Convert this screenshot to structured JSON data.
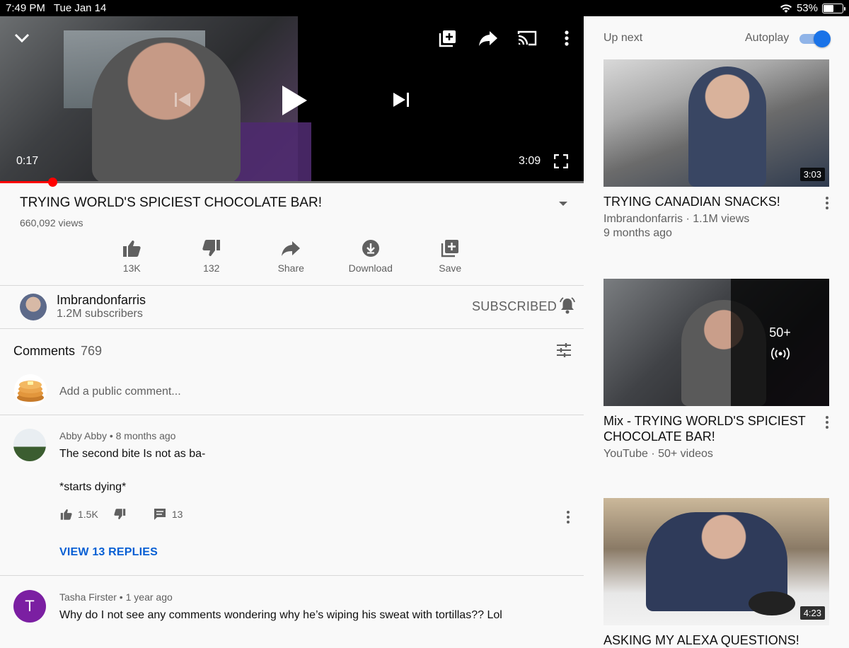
{
  "status": {
    "time": "7:49 PM",
    "date": "Tue Jan 14",
    "battery": "53%",
    "battery_level": 0.53
  },
  "player": {
    "current_time": "0:17",
    "duration": "3:09",
    "progress": 0.09
  },
  "video": {
    "title": "TRYING WORLD'S SPICIEST CHOCOLATE BAR!",
    "views": "660,092 views",
    "actions": [
      {
        "label": "13K",
        "icon": "thumbs-up-icon"
      },
      {
        "label": "132",
        "icon": "thumbs-down-icon"
      },
      {
        "label": "Share",
        "icon": "share-icon"
      },
      {
        "label": "Download",
        "icon": "download-icon"
      },
      {
        "label": "Save",
        "icon": "save-icon"
      }
    ]
  },
  "channel": {
    "name": "Imbrandonfarris",
    "subscribers": "1.2M subscribers",
    "subscribe_label": "SUBSCRIBED"
  },
  "comments": {
    "label": "Comments",
    "count": "769",
    "placeholder": "Add a public comment...",
    "items": [
      {
        "author": "Abby Abby",
        "age": "8 months ago",
        "line1": "The second bite Is not as ba-",
        "line2": "*starts dying*",
        "likes": "1.5K",
        "replies_count": "13",
        "view_replies": "VIEW 13 REPLIES"
      },
      {
        "author": "Tasha Firster",
        "age": "1 year ago",
        "initial": "T",
        "text": "Why do I not see any comments wondering why he’s wiping his sweat with tortillas?? Lol"
      }
    ]
  },
  "sidebar": {
    "up_next": "Up next",
    "autoplay": "Autoplay",
    "videos": [
      {
        "title": "TRYING CANADIAN SNACKS!",
        "channel_views": "Imbrandonfarris · 1.1M views",
        "age": "9 months ago",
        "duration": "3:03"
      },
      {
        "title": "Mix - TRYING WORLD'S SPICIEST CHOCOLATE BAR!",
        "channel_views": "YouTube · 50+ videos",
        "mix_count": "50+"
      },
      {
        "title": "ASKING MY ALEXA QUESTIONS!",
        "duration": "4:23"
      }
    ]
  },
  "colors": {
    "accent": "#065fd4",
    "progress": "#ff0000",
    "toggle": "#1a73e8",
    "tasha_avatar": "#7b1fa2"
  }
}
